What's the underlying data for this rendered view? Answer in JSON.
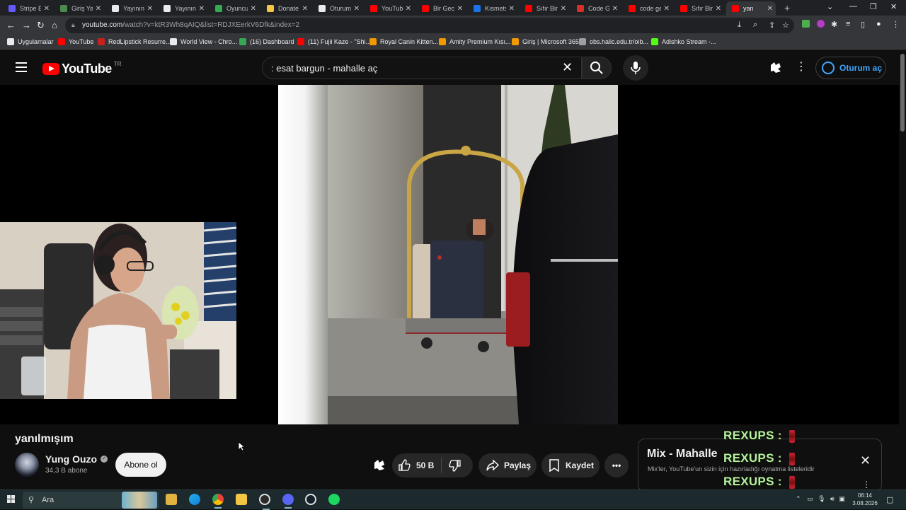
{
  "browser": {
    "tabs": [
      {
        "title": "Stripe Ex",
        "color": "#635bff"
      },
      {
        "title": "Giriş Yap",
        "color": "#4c8c4a"
      },
      {
        "title": "Yayının",
        "color": "#e8eaed"
      },
      {
        "title": "Yayının",
        "color": "#e8eaed"
      },
      {
        "title": "Oyuncu",
        "color": "#34a853"
      },
      {
        "title": "Donate",
        "color": "#f2c744"
      },
      {
        "title": "Oturum",
        "color": "#e8eaed"
      },
      {
        "title": "YouTube",
        "color": "#ff0000"
      },
      {
        "title": "Bir Gece",
        "color": "#ff0000"
      },
      {
        "title": "Kısmetse",
        "color": "#1a73e8"
      },
      {
        "title": "Sıfır Bir",
        "color": "#ff0000"
      },
      {
        "title": "Code G",
        "color": "#d93025"
      },
      {
        "title": "code ge",
        "color": "#ff0000"
      },
      {
        "title": "Sıfır Bir",
        "color": "#ff0000"
      },
      {
        "title": "yan",
        "color": "#ff0000",
        "active": true
      }
    ],
    "url_host": "youtube.com",
    "url_path": "/watch?v=ktR3Wh8qAIQ&list=RDJXEerkV6Dfk&index=2",
    "bookmarks": [
      {
        "label": "Uygulamalar",
        "color": "#e8eaed"
      },
      {
        "label": "YouTube",
        "color": "#ff0000"
      },
      {
        "label": "RedLipstick Resurre...",
        "color": "#c5221f"
      },
      {
        "label": "World View - Chro...",
        "color": "#e8eaed"
      },
      {
        "label": "(16) Dashboard",
        "color": "#34a853"
      },
      {
        "label": "(11) Fujii Kaze - \"Shi...",
        "color": "#ff0000"
      },
      {
        "label": "Royal Canin Kitten...",
        "color": "#f29900"
      },
      {
        "label": "Amity Premium Kısı...",
        "color": "#f29900"
      },
      {
        "label": "Giriş | Microsoft 365",
        "color": "#f29900"
      },
      {
        "label": "obs.halic.edu.tr/oib...",
        "color": "#9aa0a6"
      },
      {
        "label": "Adishko Stream -...",
        "color": "#53fc18"
      }
    ]
  },
  "youtube": {
    "logo_text": "YouTube",
    "country_code": "TR",
    "search_query": ": esat bargun - mahalle aç",
    "signin_label": "Oturum aç"
  },
  "video": {
    "title": "yanılmışım",
    "channel_name": "Yung Ouzo",
    "subscribers": "34,3 B abone",
    "subscribe_label": "Abone ol",
    "likes": "50 B",
    "share_label": "Paylaş",
    "save_label": "Kaydet"
  },
  "mix": {
    "title": "Mix - Mahalle",
    "subtitle": "Mix'ler, YouTube'un sizin için hazırladığı oynatma listeleridir",
    "overlay_label": "REXUPS :"
  },
  "taskbar": {
    "search_placeholder": "Ara",
    "time": "06:14",
    "date": "3.08.2026"
  }
}
